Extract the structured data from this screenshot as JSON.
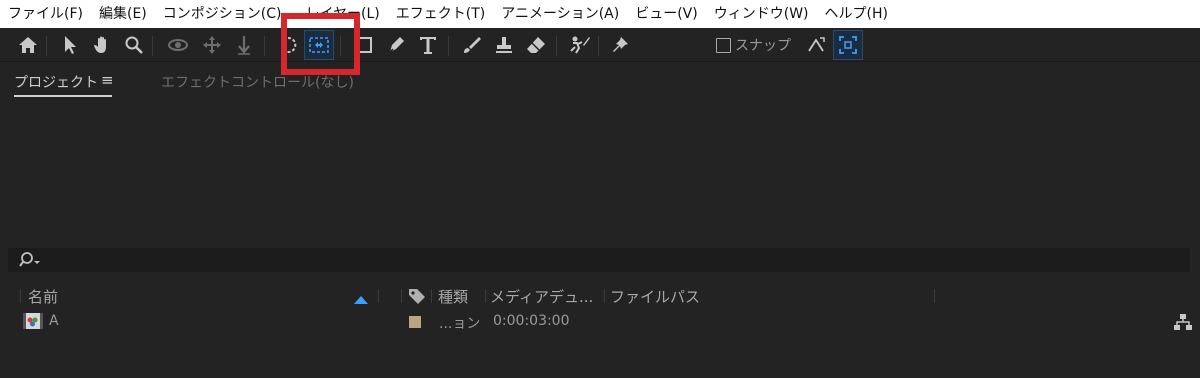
{
  "menubar": {
    "items": [
      "ファイル(F)",
      "編集(E)",
      "コンポジション(C)",
      "レイヤー(L)",
      "エフェクト(T)",
      "アニメーション(A)",
      "ビュー(V)",
      "ウィンドウ(W)",
      "ヘルプ(H)"
    ]
  },
  "toolbar": {
    "snap_label": "スナップ",
    "tools": [
      "home-icon",
      "selection-arrow-icon",
      "hand-icon",
      "zoom-icon",
      "orbit-camera-icon",
      "pan-camera-icon",
      "dolly-camera-icon",
      "rotate-icon",
      "pan-behind-icon",
      "rectangle-icon",
      "pen-icon",
      "text-icon",
      "brush-icon",
      "clone-stamp-icon",
      "eraser-icon",
      "roto-brush-icon",
      "puppet-pin-icon",
      "snap-grid-icon",
      "snap-expand-icon"
    ],
    "active_color": "#3aa0ff",
    "highlight_color": "#d6282c"
  },
  "panel": {
    "tab_project": "プロジェクト",
    "tab_menu": "≡",
    "tab_effect": "エフェクトコントロール(なし)"
  },
  "search": {
    "icon": "search-icon"
  },
  "columns": {
    "name": "名前",
    "type": "種類",
    "media_duration": "メディアデュ...",
    "file_path": "ファイルパス"
  },
  "rows": [
    {
      "name": "A",
      "type": "...ョン",
      "duration": "0:00:03:00",
      "label_color": "#b9a582"
    }
  ]
}
